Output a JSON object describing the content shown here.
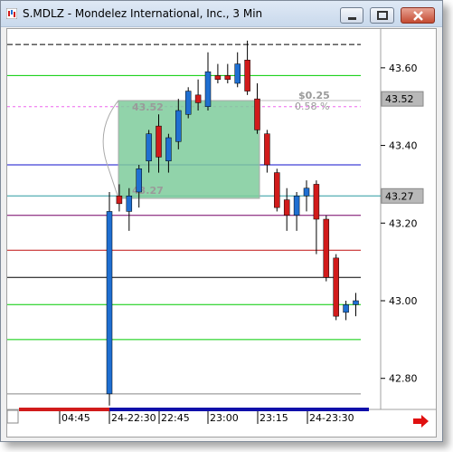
{
  "window": {
    "title": "S.MDLZ - Mondelez International, Inc., 3 Min",
    "icon": "chart-app-icon"
  },
  "controls": {
    "minimize_icon": "minimize-icon",
    "maximize_icon": "maximize-icon",
    "close_icon": "close-icon"
  },
  "price_axis": {
    "ticks": [
      "43.60",
      "43.40",
      "43.20",
      "43.00",
      "42.80"
    ],
    "markers": [
      {
        "label": "43.52"
      },
      {
        "label": "43.27"
      }
    ]
  },
  "time_axis": {
    "ticks": [
      "04:45",
      "24-22:30",
      "22:45",
      "23:00",
      "23:15",
      "24-23:30"
    ]
  },
  "measurement": {
    "high_label": "43.52",
    "low_label": "43.27",
    "change": "$0.25",
    "percent": "0.58 %"
  },
  "colors": {
    "up_candle": "#1f6fd1",
    "down_candle": "#d11b1b",
    "measure_fill": "#7ecb9b",
    "scroll_arrow": "#e01010"
  },
  "chart_data": {
    "type": "candlestick",
    "title": "S.MDLZ - Mondelez International, Inc., 3 Min",
    "ylim": [
      42.72,
      43.7
    ],
    "candles": [
      {
        "o": 43.23,
        "h": 43.28,
        "l": 42.73,
        "c": 42.76,
        "dir": "up"
      },
      {
        "o": 43.27,
        "h": 43.3,
        "l": 43.23,
        "c": 43.25,
        "dir": "down"
      },
      {
        "o": 43.23,
        "h": 43.29,
        "l": 43.18,
        "c": 43.27,
        "dir": "up"
      },
      {
        "o": 43.28,
        "h": 43.35,
        "l": 43.24,
        "c": 43.34,
        "dir": "up"
      },
      {
        "o": 43.36,
        "h": 43.44,
        "l": 43.33,
        "c": 43.43,
        "dir": "up"
      },
      {
        "o": 43.45,
        "h": 43.48,
        "l": 43.33,
        "c": 43.37,
        "dir": "down"
      },
      {
        "o": 43.36,
        "h": 43.43,
        "l": 43.33,
        "c": 43.42,
        "dir": "up"
      },
      {
        "o": 43.41,
        "h": 43.52,
        "l": 43.39,
        "c": 43.49,
        "dir": "up"
      },
      {
        "o": 43.48,
        "h": 43.55,
        "l": 43.47,
        "c": 43.54,
        "dir": "up"
      },
      {
        "o": 43.53,
        "h": 43.57,
        "l": 43.49,
        "c": 43.51,
        "dir": "down"
      },
      {
        "o": 43.5,
        "h": 43.64,
        "l": 43.49,
        "c": 43.59,
        "dir": "up"
      },
      {
        "o": 43.58,
        "h": 43.61,
        "l": 43.56,
        "c": 43.57,
        "dir": "down"
      },
      {
        "o": 43.58,
        "h": 43.61,
        "l": 43.56,
        "c": 43.57,
        "dir": "down"
      },
      {
        "o": 43.56,
        "h": 43.64,
        "l": 43.55,
        "c": 43.61,
        "dir": "up"
      },
      {
        "o": 43.62,
        "h": 43.67,
        "l": 43.53,
        "c": 43.54,
        "dir": "down"
      },
      {
        "o": 43.52,
        "h": 43.56,
        "l": 43.43,
        "c": 43.44,
        "dir": "down"
      },
      {
        "o": 43.43,
        "h": 43.44,
        "l": 43.33,
        "c": 43.35,
        "dir": "down"
      },
      {
        "o": 43.33,
        "h": 43.34,
        "l": 43.23,
        "c": 43.24,
        "dir": "down"
      },
      {
        "o": 43.26,
        "h": 43.29,
        "l": 43.18,
        "c": 43.22,
        "dir": "down"
      },
      {
        "o": 43.22,
        "h": 43.28,
        "l": 43.18,
        "c": 43.27,
        "dir": "up"
      },
      {
        "o": 43.27,
        "h": 43.31,
        "l": 43.23,
        "c": 43.29,
        "dir": "up"
      },
      {
        "o": 43.3,
        "h": 43.31,
        "l": 43.12,
        "c": 43.21,
        "dir": "down"
      },
      {
        "o": 43.21,
        "h": 43.22,
        "l": 43.05,
        "c": 43.06,
        "dir": "down"
      },
      {
        "o": 43.11,
        "h": 43.12,
        "l": 42.95,
        "c": 42.96,
        "dir": "down"
      },
      {
        "o": 42.97,
        "h": 43.0,
        "l": 42.95,
        "c": 42.99,
        "dir": "up"
      },
      {
        "o": 42.99,
        "h": 43.02,
        "l": 42.96,
        "c": 43.0,
        "dir": "up"
      }
    ],
    "reference_lines": [
      {
        "value": 43.66,
        "color": "#000000",
        "style": "dashed"
      },
      {
        "value": 43.58,
        "color": "#00cc00",
        "style": "solid"
      },
      {
        "value": 43.5,
        "color": "#ee66ee",
        "style": "dashed"
      },
      {
        "value": 43.35,
        "color": "#1010cc",
        "style": "solid"
      },
      {
        "value": 43.27,
        "color": "#2a9aa0",
        "style": "solid"
      },
      {
        "value": 43.22,
        "color": "#770066",
        "style": "solid"
      },
      {
        "value": 43.13,
        "color": "#c01010",
        "style": "solid"
      },
      {
        "value": 43.06,
        "color": "#000000",
        "style": "solid"
      },
      {
        "value": 42.99,
        "color": "#00cc00",
        "style": "solid"
      },
      {
        "value": 42.9,
        "color": "#00cc00",
        "style": "solid"
      },
      {
        "value": 42.76,
        "color": "#888888",
        "style": "solid"
      }
    ]
  }
}
